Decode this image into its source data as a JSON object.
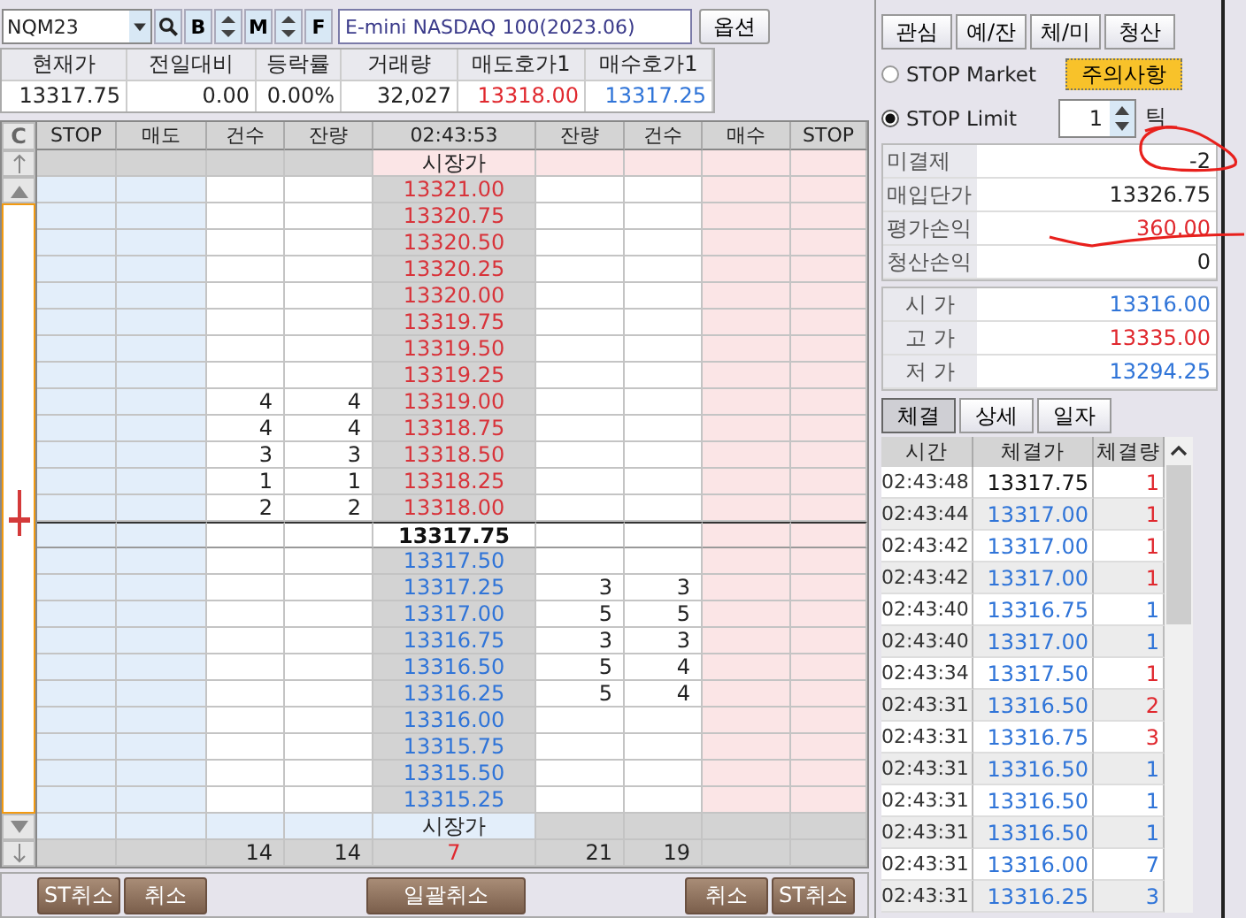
{
  "symbol": {
    "code": "NQM23",
    "name": "E-mini NASDAQ 100(2023.06)"
  },
  "symbol_buttons": [
    "B",
    "M",
    "F"
  ],
  "option_button": "옵션",
  "quote": {
    "columns": [
      "현재가",
      "전일대비",
      "등락률",
      "거래량",
      "매도호가1",
      "매수호가1"
    ],
    "values": [
      {
        "text": "13317.75",
        "color": "#222222"
      },
      {
        "text": "0.00",
        "color": "#222222"
      },
      {
        "text": "0.00%",
        "color": "#222222"
      },
      {
        "text": "32,027",
        "color": "#222222"
      },
      {
        "text": "13318.00",
        "color": "#e0282e"
      },
      {
        "text": "13317.25",
        "color": "#2f74d8"
      }
    ]
  },
  "orderbook": {
    "clear_button": "C",
    "columns": [
      "STOP",
      "매도",
      "건수",
      "잔량",
      "02:43:53",
      "잔량",
      "건수",
      "매수",
      "STOP"
    ],
    "market_top": "시장가",
    "ask_rows": [
      {
        "price": "13321.00"
      },
      {
        "price": "13320.75"
      },
      {
        "price": "13320.50"
      },
      {
        "price": "13320.25"
      },
      {
        "price": "13320.00"
      },
      {
        "price": "13319.75"
      },
      {
        "price": "13319.50"
      },
      {
        "price": "13319.25"
      },
      {
        "price": "13319.00",
        "count": "4",
        "qty": "4"
      },
      {
        "price": "13318.75",
        "count": "4",
        "qty": "4"
      },
      {
        "price": "13318.50",
        "count": "3",
        "qty": "3"
      },
      {
        "price": "13318.25",
        "count": "1",
        "qty": "1"
      },
      {
        "price": "13318.00",
        "count": "2",
        "qty": "2"
      }
    ],
    "current_price": "13317.75",
    "bid_rows": [
      {
        "price": "13317.50"
      },
      {
        "price": "13317.25",
        "qty": "3",
        "count": "3"
      },
      {
        "price": "13317.00",
        "qty": "5",
        "count": "5"
      },
      {
        "price": "13316.75",
        "qty": "3",
        "count": "3"
      },
      {
        "price": "13316.50",
        "qty": "5",
        "count": "4"
      },
      {
        "price": "13316.25",
        "qty": "5",
        "count": "4"
      },
      {
        "price": "13316.00"
      },
      {
        "price": "13315.75"
      },
      {
        "price": "13315.50"
      },
      {
        "price": "13315.25"
      }
    ],
    "market_bottom": "시장가",
    "totals": {
      "ask_count": "14",
      "ask_qty": "14",
      "diff": "7",
      "bid_qty": "21",
      "bid_count": "19"
    }
  },
  "footer_buttons": {
    "left": [
      "ST취소",
      "취소"
    ],
    "center": "일괄취소",
    "right": [
      "취소",
      "ST취소"
    ]
  },
  "panel_buttons": [
    "관심",
    "예/잔",
    "체/미",
    "청산"
  ],
  "stop_types": [
    {
      "label": "STOP Market",
      "selected": false
    },
    {
      "label": "STOP Limit",
      "selected": true
    }
  ],
  "notice_button": "주의사항",
  "tick": {
    "value": "1",
    "unit": "틱"
  },
  "position": [
    {
      "label": "미결제",
      "value": "-2",
      "color": "#222222"
    },
    {
      "label": "매입단가",
      "value": "13326.75",
      "color": "#222222"
    },
    {
      "label": "평가손익",
      "value": "360.00",
      "color": "#e0282e"
    },
    {
      "label": "청산손익",
      "value": "0",
      "color": "#222222"
    }
  ],
  "prices": [
    {
      "label": "시 가",
      "value": "13316.00",
      "color": "#2f74d8"
    },
    {
      "label": "고 가",
      "value": "13335.00",
      "color": "#e0282e"
    },
    {
      "label": "저 가",
      "value": "13294.25",
      "color": "#2f74d8"
    }
  ],
  "trade_tabs": [
    {
      "label": "체결",
      "selected": true
    },
    {
      "label": "상세",
      "selected": false
    },
    {
      "label": "일자",
      "selected": false
    }
  ],
  "trades": {
    "columns": [
      "시간",
      "체결가",
      "체결량"
    ],
    "rows": [
      {
        "time": "02:43:48",
        "price": {
          "text": "13317.75",
          "color": "#111111"
        },
        "qty": {
          "text": "1",
          "color": "#e0282e"
        }
      },
      {
        "time": "02:43:44",
        "price": {
          "text": "13317.00",
          "color": "#2f74d8"
        },
        "qty": {
          "text": "1",
          "color": "#e0282e"
        }
      },
      {
        "time": "02:43:42",
        "price": {
          "text": "13317.00",
          "color": "#2f74d8"
        },
        "qty": {
          "text": "1",
          "color": "#e0282e"
        }
      },
      {
        "time": "02:43:42",
        "price": {
          "text": "13317.00",
          "color": "#2f74d8"
        },
        "qty": {
          "text": "1",
          "color": "#e0282e"
        }
      },
      {
        "time": "02:43:40",
        "price": {
          "text": "13316.75",
          "color": "#2f74d8"
        },
        "qty": {
          "text": "1",
          "color": "#2f74d8"
        }
      },
      {
        "time": "02:43:40",
        "price": {
          "text": "13317.00",
          "color": "#2f74d8"
        },
        "qty": {
          "text": "1",
          "color": "#2f74d8"
        }
      },
      {
        "time": "02:43:34",
        "price": {
          "text": "13317.50",
          "color": "#2f74d8"
        },
        "qty": {
          "text": "1",
          "color": "#e0282e"
        }
      },
      {
        "time": "02:43:31",
        "price": {
          "text": "13316.50",
          "color": "#2f74d8"
        },
        "qty": {
          "text": "2",
          "color": "#e0282e"
        }
      },
      {
        "time": "02:43:31",
        "price": {
          "text": "13316.75",
          "color": "#2f74d8"
        },
        "qty": {
          "text": "3",
          "color": "#e0282e"
        }
      },
      {
        "time": "02:43:31",
        "price": {
          "text": "13316.50",
          "color": "#2f74d8"
        },
        "qty": {
          "text": "1",
          "color": "#2f74d8"
        }
      },
      {
        "time": "02:43:31",
        "price": {
          "text": "13316.50",
          "color": "#2f74d8"
        },
        "qty": {
          "text": "1",
          "color": "#2f74d8"
        }
      },
      {
        "time": "02:43:31",
        "price": {
          "text": "13316.50",
          "color": "#2f74d8"
        },
        "qty": {
          "text": "1",
          "color": "#2f74d8"
        }
      },
      {
        "time": "02:43:31",
        "price": {
          "text": "13316.00",
          "color": "#2f74d8"
        },
        "qty": {
          "text": "7",
          "color": "#2f74d8"
        }
      },
      {
        "time": "02:43:31",
        "price": {
          "text": "13316.25",
          "color": "#2f74d8"
        },
        "qty": {
          "text": "3",
          "color": "#2f74d8"
        }
      }
    ]
  }
}
